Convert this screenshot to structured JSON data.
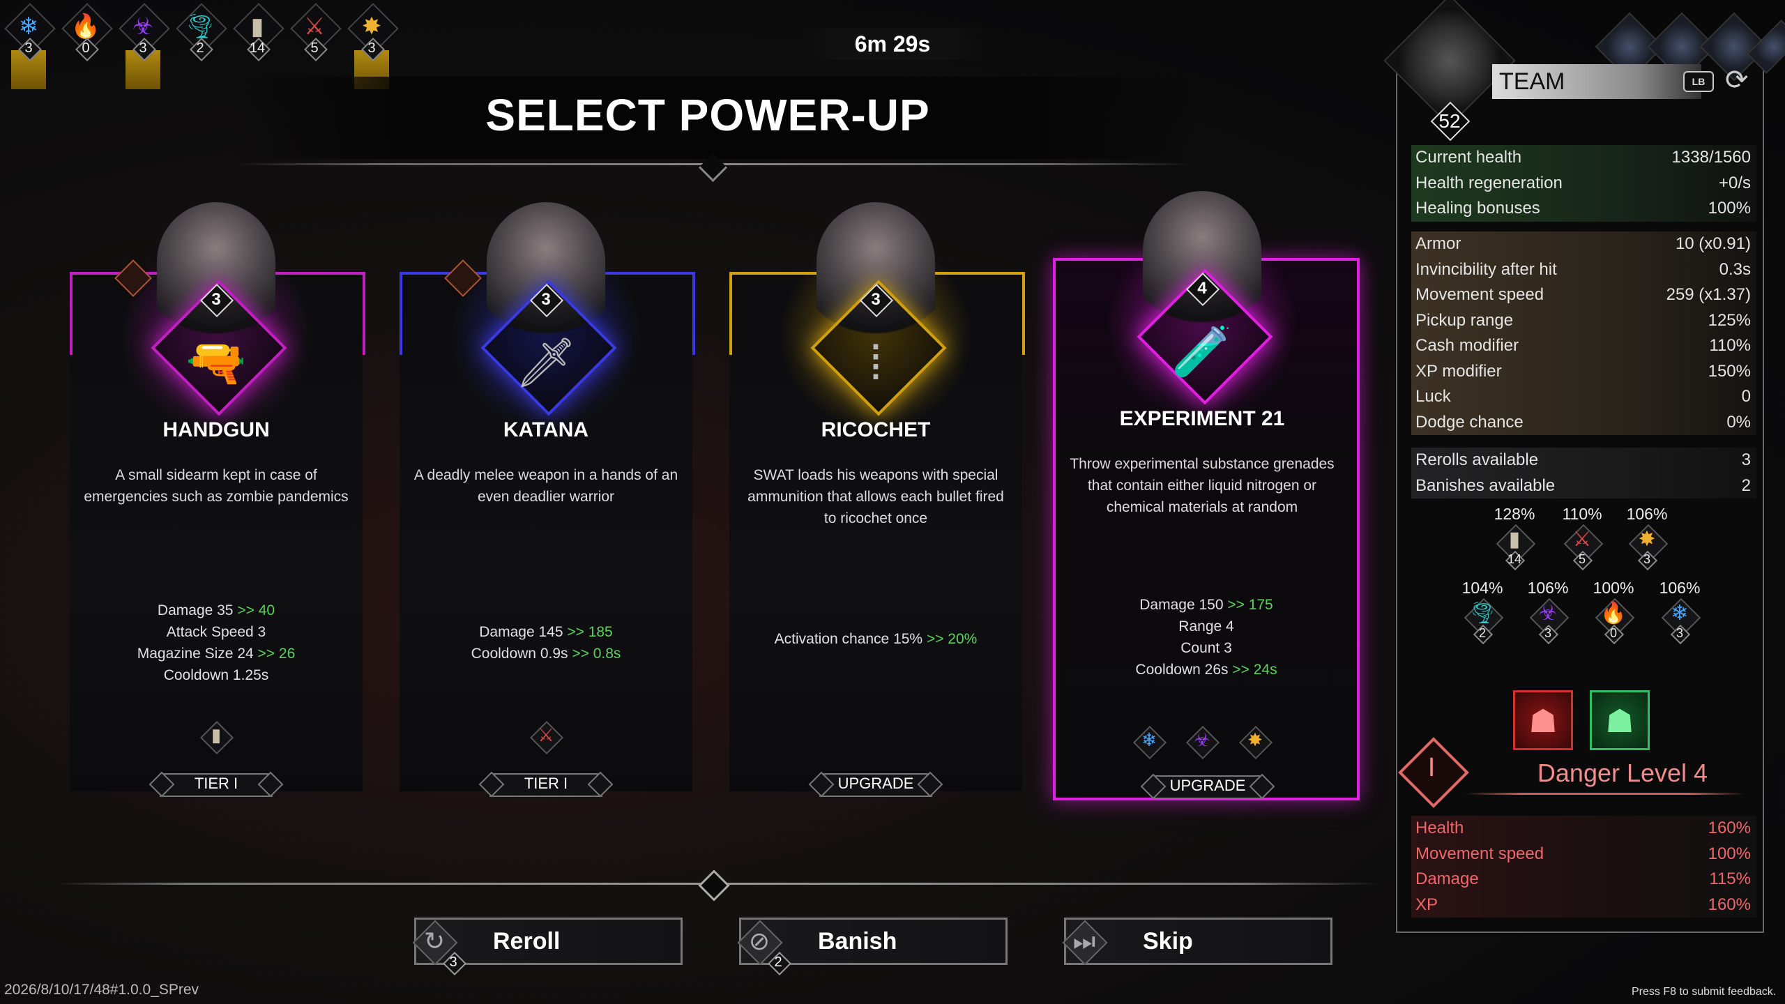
{
  "top_elements": [
    {
      "icon": "snowflake-icon",
      "glyph": "❄",
      "color": "#4aa8ff",
      "count": "3",
      "active": true
    },
    {
      "icon": "fire-icon",
      "glyph": "🔥",
      "color": "#ff6a2a",
      "count": "0",
      "active": false
    },
    {
      "icon": "biohazard-icon",
      "glyph": "☣",
      "color": "#9a3cff",
      "count": "3",
      "active": true
    },
    {
      "icon": "tornado-icon",
      "glyph": "🌪",
      "color": "#2ad0d0",
      "count": "2",
      "active": false
    },
    {
      "icon": "bullet-icon",
      "glyph": "▮",
      "color": "#c8c0a8",
      "count": "14",
      "active": false
    },
    {
      "icon": "blade-icon",
      "glyph": "⚔",
      "color": "#e04848",
      "count": "5",
      "active": false
    },
    {
      "icon": "spark-icon",
      "glyph": "✸",
      "color": "#f0b030",
      "count": "3",
      "active": true
    }
  ],
  "timer": "6m 29s",
  "title": "SELECT POWER-UP",
  "cards": [
    {
      "name": "HANDGUN",
      "color": "#c020c0",
      "level": "3",
      "weapon_glyph": "🔫",
      "desc": "A small sidearm kept in case of emergencies such as zombie pandemics",
      "stats": [
        {
          "text": "Damage 35",
          "up": " >> 40"
        },
        {
          "text": "Attack Speed 3",
          "up": ""
        },
        {
          "text": "Magazine Size 24",
          "up": " >> 26"
        },
        {
          "text": "Cooldown 1.25s",
          "up": ""
        }
      ],
      "small_icon": "bullet-icon",
      "small_glyph": "▮",
      "small_color": "#c8c0a8",
      "pill": "TIER I"
    },
    {
      "name": "KATANA",
      "color": "#3a3ae0",
      "level": "3",
      "weapon_glyph": "🗡",
      "desc": "A deadly melee weapon in a hands of an even deadlier warrior",
      "stats": [
        {
          "text": "Damage 145",
          "up": " >> 185"
        },
        {
          "text": "Cooldown 0.9s",
          "up": " >> 0.8s"
        }
      ],
      "small_icon": "blade-icon",
      "small_glyph": "⚔",
      "small_color": "#e04848",
      "pill": "TIER I"
    },
    {
      "name": "RICOCHET",
      "color": "#d0a010",
      "level": "3",
      "weapon_glyph": "⁞",
      "desc": "SWAT loads his weapons with special ammunition that allows each bullet fired to ricochet once",
      "stats": [
        {
          "text": "Activation chance 15%",
          "up": " >> 20%"
        }
      ],
      "small_icon": "",
      "small_glyph": "",
      "small_color": "#888",
      "pill": "UPGRADE"
    },
    {
      "name": "EXPERIMENT 21",
      "color": "#e020e0",
      "level": "4",
      "weapon_glyph": "🧪",
      "desc": "Throw experimental substance grenades that contain either liquid nitrogen or chemical materials at random",
      "stats": [
        {
          "text": "Damage 150",
          "up": " >> 175"
        },
        {
          "text": "Range 4",
          "up": ""
        },
        {
          "text": "Count 3",
          "up": ""
        },
        {
          "text": "Cooldown 26s",
          "up": " >> 24s"
        }
      ],
      "pill": "UPGRADE"
    }
  ],
  "buttons": [
    {
      "label": "Reroll",
      "count": "3",
      "icon": "reroll-icon",
      "glyph": "↻"
    },
    {
      "label": "Banish",
      "count": "2",
      "icon": "banish-icon",
      "glyph": "⊘"
    },
    {
      "label": "Skip",
      "count": "",
      "icon": "skip-icon",
      "glyph": "⏭"
    }
  ],
  "version": "2026/8/10/17/48#1.0.0_SPrev",
  "feedback": "Press F8 to submit feedback.",
  "panel": {
    "team_label": "TEAM",
    "lb_label": "LB",
    "level": "52",
    "stats_health": [
      {
        "label": "Current health",
        "value": "1338/1560"
      },
      {
        "label": "Health regeneration",
        "value": "+0/s"
      },
      {
        "label": "Healing bonuses",
        "value": "100%"
      }
    ],
    "stats_main": [
      {
        "label": "Armor",
        "value": "10 (x0.91)"
      },
      {
        "label": "Invincibility after hit",
        "value": "0.3s"
      },
      {
        "label": "Movement speed",
        "value": "259 (x1.37)"
      },
      {
        "label": "Pickup range",
        "value": "125%"
      },
      {
        "label": "Cash modifier",
        "value": "110%"
      },
      {
        "label": "XP modifier",
        "value": "150%"
      },
      {
        "label": "Luck",
        "value": "0"
      },
      {
        "label": "Dodge chance",
        "value": "0%"
      }
    ],
    "stats_misc": [
      {
        "label": "Rerolls available",
        "value": "3"
      },
      {
        "label": "Banishes available",
        "value": "2"
      }
    ],
    "elements_row1": [
      {
        "pct": "128%",
        "icon": "bullet-icon",
        "glyph": "▮",
        "color": "#c8c0a8",
        "count": "14"
      },
      {
        "pct": "110%",
        "icon": "blade-icon",
        "glyph": "⚔",
        "color": "#e04848",
        "count": "5"
      },
      {
        "pct": "106%",
        "icon": "spark-icon",
        "glyph": "✸",
        "color": "#f0b030",
        "count": "3"
      }
    ],
    "elements_row2": [
      {
        "pct": "104%",
        "icon": "tornado-icon",
        "glyph": "🌪",
        "color": "#2ad0d0",
        "count": "2"
      },
      {
        "pct": "106%",
        "icon": "biohazard-icon",
        "glyph": "☣",
        "color": "#9a3cff",
        "count": "3"
      },
      {
        "pct": "100%",
        "icon": "fire-icon",
        "glyph": "🔥",
        "color": "#ff6a2a",
        "count": "0"
      },
      {
        "pct": "106%",
        "icon": "snowflake-icon",
        "glyph": "❄",
        "color": "#4aa8ff",
        "count": "3"
      }
    ],
    "danger_level_numeral": "I",
    "danger_title": "Danger Level 4",
    "danger_stats": [
      {
        "label": "Health",
        "value": "160%"
      },
      {
        "label": "Movement speed",
        "value": "100%"
      },
      {
        "label": "Damage",
        "value": "115%"
      },
      {
        "label": "XP",
        "value": "160%"
      }
    ]
  }
}
